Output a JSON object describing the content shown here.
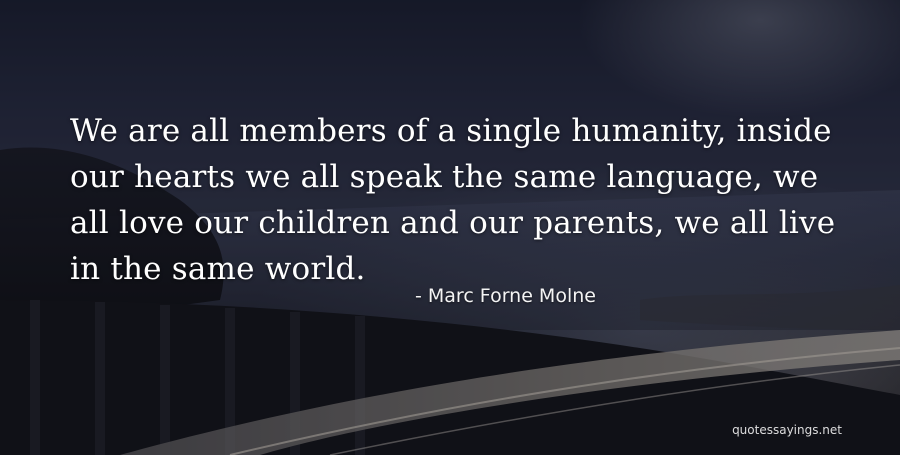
{
  "quote": {
    "text": "We are all members of a single humanity, inside our hearts we all speak the same language, we all love our children and our parents, we all live in the same world.",
    "author": "- Marc Forne Molne"
  },
  "watermark": {
    "text": "quotessayings.net"
  },
  "background": {
    "description_icon": "coastal-bridge-road-image",
    "colors": {
      "sky_top": "#1d2236",
      "sea": "#3a4158",
      "road_light": "#b9b3aa"
    }
  }
}
